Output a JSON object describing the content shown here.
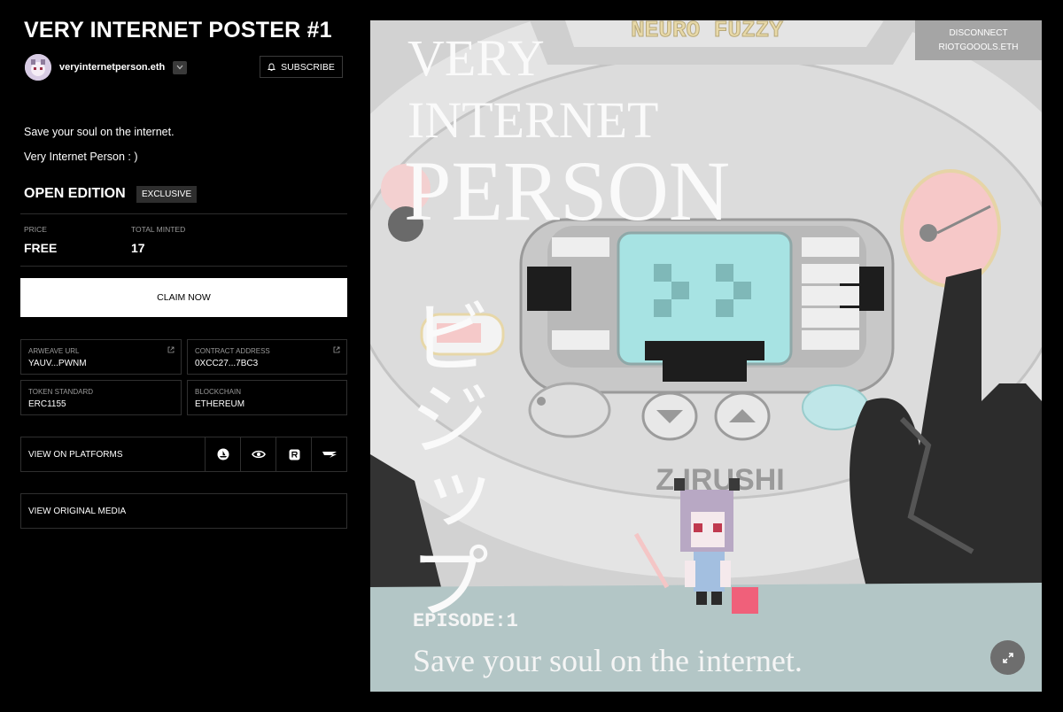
{
  "title": "VERY INTERNET POSTER #1",
  "creator": {
    "name": "veryinternetperson.eth"
  },
  "subscribe_label": "SUBSCRIBE",
  "description": [
    "Save your soul on the internet.",
    "Very Internet Person : )"
  ],
  "edition": {
    "label": "OPEN EDITION",
    "badge": "EXCLUSIVE"
  },
  "stats": {
    "price_label": "PRICE",
    "price_value": "FREE",
    "minted_label": "TOTAL MINTED",
    "minted_value": "17"
  },
  "claim_label": "CLAIM NOW",
  "details": {
    "arweave_label": "ARWEAVE URL",
    "arweave_value": "YAUV...PWNM",
    "contract_label": "CONTRACT ADDRESS",
    "contract_value": "0XCC27...7BC3",
    "standard_label": "TOKEN STANDARD",
    "standard_value": "ERC1155",
    "chain_label": "BLOCKCHAIN",
    "chain_value": "ETHEREUM"
  },
  "platforms_label": "VIEW ON PLATFORMS",
  "platform_icons": [
    "opensea-icon",
    "eye-icon",
    "rarible-icon",
    "zora-icon"
  ],
  "original_media_label": "VIEW ORIGINAL MEDIA",
  "wallet": {
    "action": "DISCONNECT",
    "account": "RIOTGOOOLS.ETH"
  },
  "artwork": {
    "brand_top": "NEURO FUZZY",
    "line1": "VERY",
    "line2": "INTERNET",
    "line3": "PERSON",
    "katakana": "ビジップ",
    "brand": "Z   IRUSHI",
    "episode": "EPISODE:1",
    "caption": "Save your soul on the internet."
  },
  "colors": {
    "background": "#000000",
    "claim_bg": "#ffffff",
    "screen": "#a7e3e3",
    "pink": "#f7c9c9"
  }
}
